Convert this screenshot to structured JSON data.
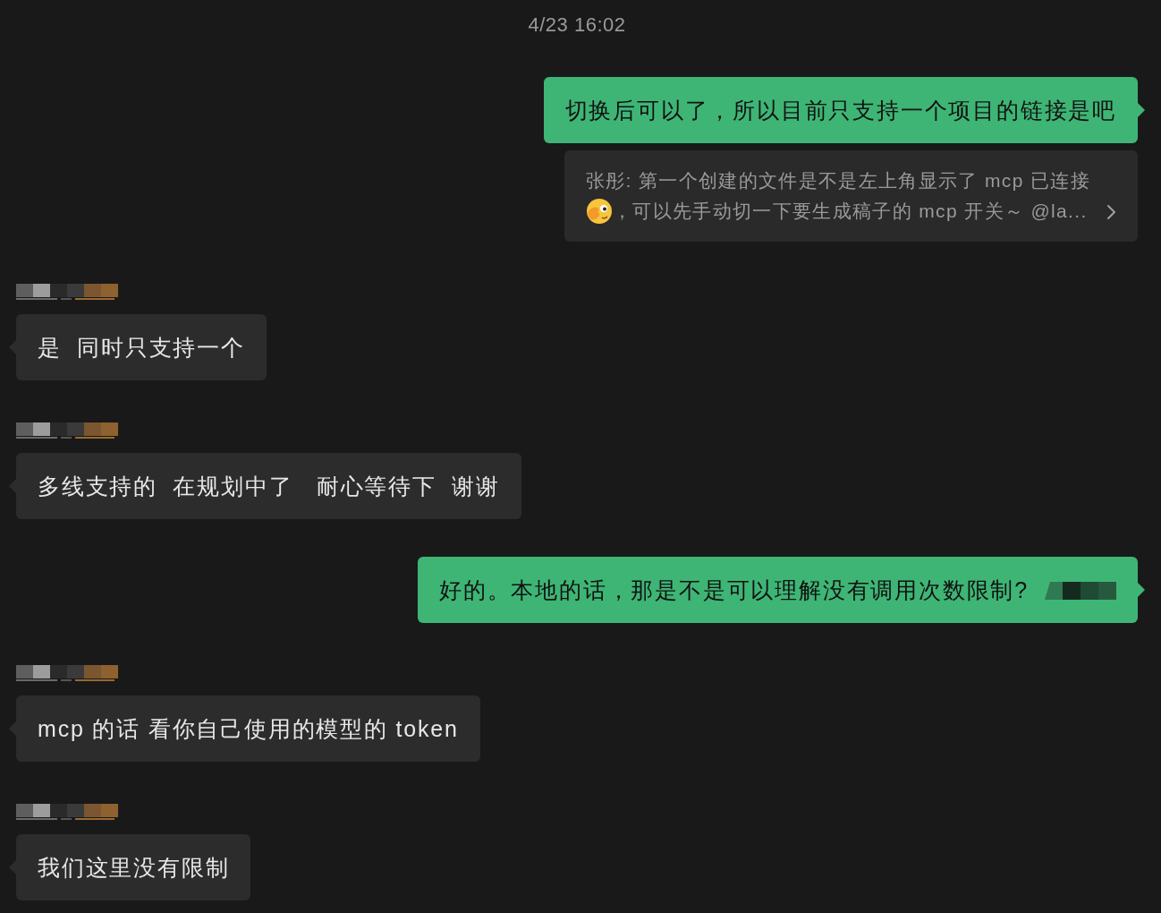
{
  "timestamp": "4/23 16:02",
  "messages": [
    {
      "kind": "outgoing",
      "text": "切换后可以了，所以目前只支持一个项目的链接是吧",
      "quote": {
        "line_1": "张彤: 第一个创建的文件是不是左上角显示了 mcp 已连接",
        "line_2": "，可以先手动切一下要生成稿子的 mcp 开关～ @la..."
      }
    },
    {
      "kind": "incoming",
      "text": "是  同时只支持一个"
    },
    {
      "kind": "incoming",
      "text": "多线支持的  在规划中了   耐心等待下  谢谢"
    },
    {
      "kind": "outgoing",
      "text": "好的。本地的话，那是不是可以理解没有调用次数限制?",
      "redacted_tail": true
    },
    {
      "kind": "incoming",
      "text": "mcp 的话 看你自己使用的模型的 token"
    },
    {
      "kind": "incoming",
      "text": "我们这里没有限制"
    }
  ]
}
